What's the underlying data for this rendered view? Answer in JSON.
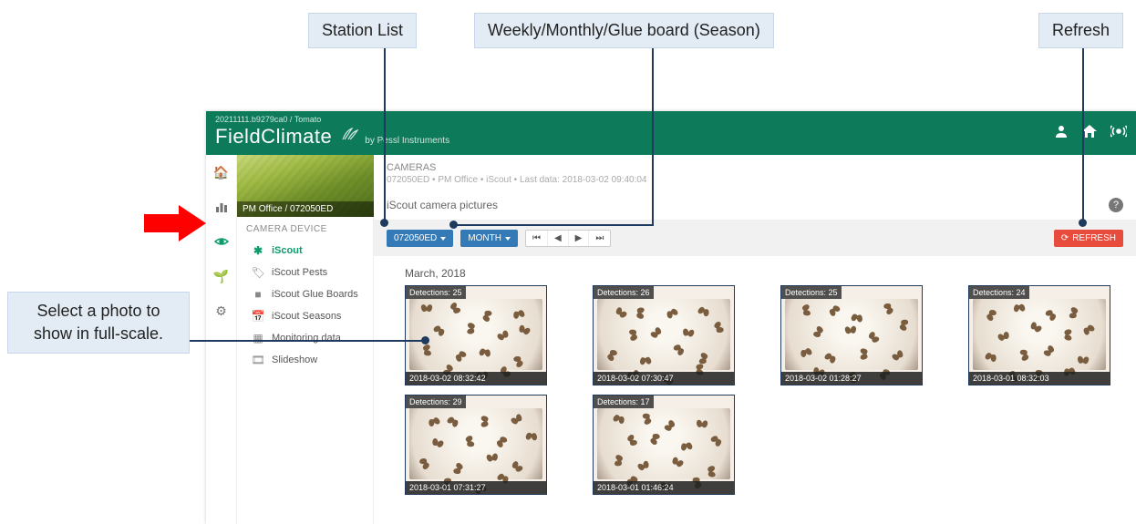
{
  "callouts": {
    "station_list": "Station List",
    "period": "Weekly/Monthly/Glue board (Season)",
    "refresh": "Refresh",
    "select_photo": "Select a photo to show in full-scale."
  },
  "header": {
    "breadcrumb": "20211111.b9279ca0 / Tomato",
    "logo_main": "FieldClimate",
    "logo_sub": "by Pessl Instruments"
  },
  "topbar_icons": {
    "user": "user-icon",
    "dashboard": "dashboard-icon",
    "broadcast": "broadcast-icon"
  },
  "leftrail": {
    "home": "home-icon",
    "chart": "bar-chart-icon",
    "eye": "eye-icon",
    "plant": "plant-icon",
    "settings": "gear-icon"
  },
  "sidebar": {
    "hero_overlay": "PM Office / 072050ED",
    "section_title": "CAMERA DEVICE",
    "items": [
      {
        "icon": "bug",
        "label": "iScout",
        "active": true
      },
      {
        "icon": "tag",
        "label": "iScout Pests"
      },
      {
        "icon": "square",
        "label": "iScout Glue Boards"
      },
      {
        "icon": "calendar",
        "label": "iScout Seasons"
      },
      {
        "icon": "grid",
        "label": "Monitoring data"
      },
      {
        "icon": "film",
        "label": "Slideshow"
      }
    ]
  },
  "main": {
    "section_title": "CAMERAS",
    "section_sub": "072050ED • PM Office • iScout • Last data: 2018-03-02 09:40:04",
    "label": "iScout camera pictures",
    "station_btn": "072050ED",
    "period_btn": "MONTH",
    "refresh_btn": "REFRESH",
    "month_label": "March, 2018",
    "help": "?"
  },
  "photos": [
    {
      "detections": "Detections: 25",
      "timestamp": "2018-03-02 08:32:42"
    },
    {
      "detections": "Detections: 26",
      "timestamp": "2018-03-02 07:30:47"
    },
    {
      "detections": "Detections: 25",
      "timestamp": "2018-03-02 01:28:27"
    },
    {
      "detections": "Detections: 24",
      "timestamp": "2018-03-01 08:32:03"
    },
    {
      "detections": "Detections: 29",
      "timestamp": "2018-03-01 07:31:27"
    },
    {
      "detections": "Detections: 17",
      "timestamp": "2018-03-01 01:46:24"
    }
  ]
}
